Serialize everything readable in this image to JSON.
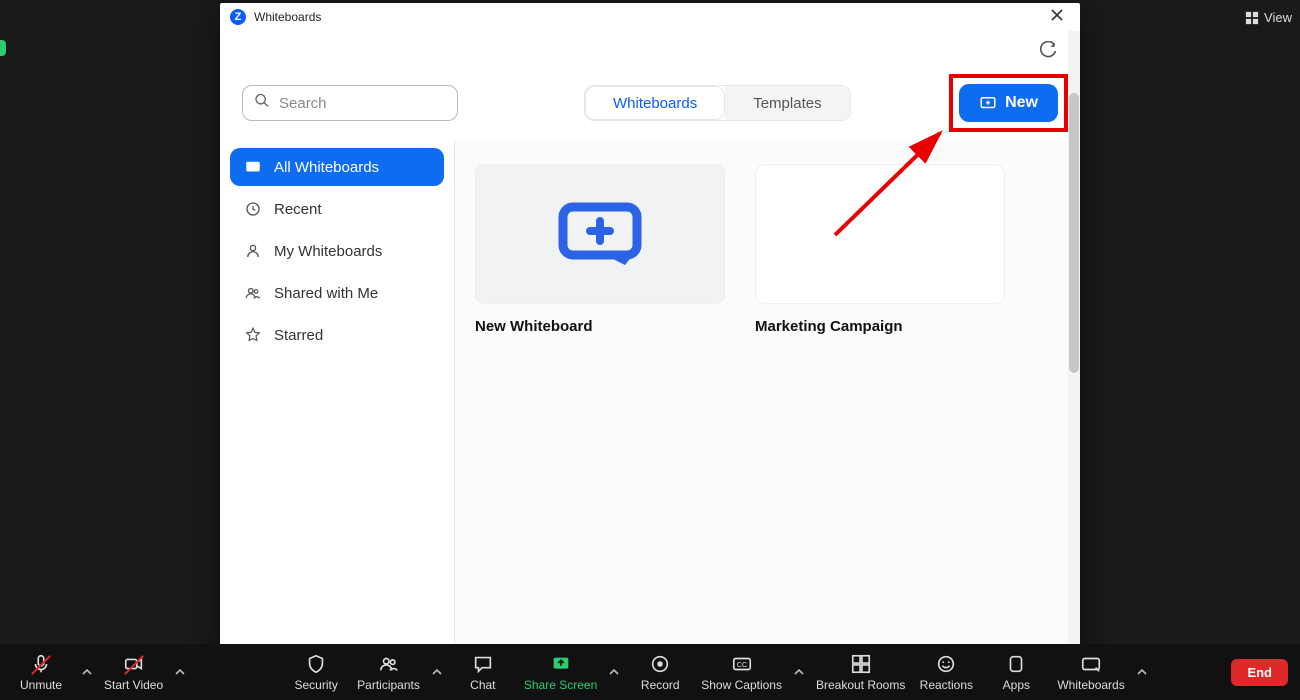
{
  "topbar": {
    "view": "View"
  },
  "modal": {
    "title": "Whiteboards",
    "search_placeholder": "Search",
    "tabs": {
      "whiteboards": "Whiteboards",
      "templates": "Templates"
    },
    "new_button": "New",
    "sidebar": {
      "items": [
        {
          "label": "All Whiteboards"
        },
        {
          "label": "Recent"
        },
        {
          "label": "My Whiteboards"
        },
        {
          "label": "Shared with Me"
        },
        {
          "label": "Starred"
        }
      ]
    },
    "cards": [
      {
        "title": "New Whiteboard"
      },
      {
        "title": "Marketing Campaign"
      }
    ]
  },
  "controls": {
    "unmute": "Unmute",
    "start_video": "Start Video",
    "security": "Security",
    "participants": "Participants",
    "chat": "Chat",
    "share_screen": "Share Screen",
    "record": "Record",
    "show_captions": "Show Captions",
    "breakout_rooms": "Breakout Rooms",
    "reactions": "Reactions",
    "apps": "Apps",
    "whiteboards": "Whiteboards",
    "end": "End"
  }
}
